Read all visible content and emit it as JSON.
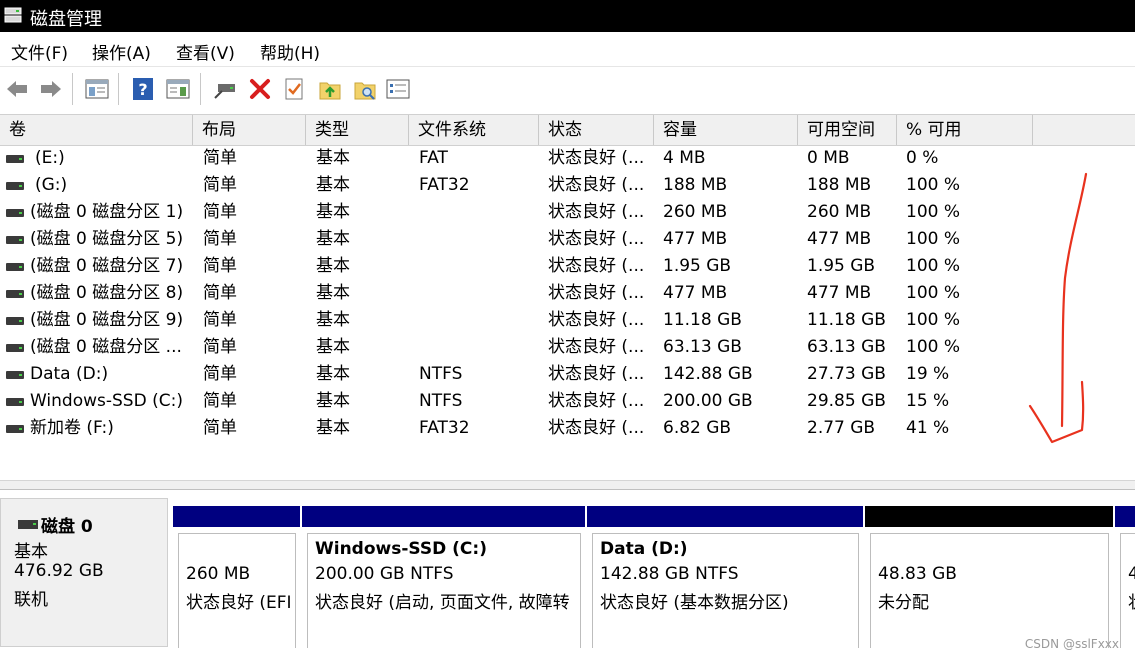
{
  "window": {
    "title": "磁盘管理"
  },
  "menu": [
    "文件(F)",
    "操作(A)",
    "查看(V)",
    "帮助(H)"
  ],
  "toolbar": [
    "back-icon",
    "forward-icon",
    "console-tree-icon",
    "help-icon",
    "action-pane-icon",
    "connect-disk-icon",
    "delete-icon",
    "check-icon",
    "folder-up-icon",
    "folder-search-icon",
    "properties-icon"
  ],
  "table": {
    "columns": [
      "卷",
      "布局",
      "类型",
      "文件系统",
      "状态",
      "容量",
      "可用空间",
      "% 可用"
    ],
    "rows": [
      [
        "(E:)",
        "简单",
        "基本",
        "FAT",
        "状态良好 (...",
        "4 MB",
        "0 MB",
        "0 %"
      ],
      [
        "(G:)",
        "简单",
        "基本",
        "FAT32",
        "状态良好 (...",
        "188 MB",
        "188 MB",
        "100 %"
      ],
      [
        "(磁盘 0 磁盘分区 1)",
        "简单",
        "基本",
        "",
        "状态良好 (...",
        "260 MB",
        "260 MB",
        "100 %"
      ],
      [
        "(磁盘 0 磁盘分区 5)",
        "简单",
        "基本",
        "",
        "状态良好 (...",
        "477 MB",
        "477 MB",
        "100 %"
      ],
      [
        "(磁盘 0 磁盘分区 7)",
        "简单",
        "基本",
        "",
        "状态良好 (...",
        "1.95 GB",
        "1.95 GB",
        "100 %"
      ],
      [
        "(磁盘 0 磁盘分区 8)",
        "简单",
        "基本",
        "",
        "状态良好 (...",
        "477 MB",
        "477 MB",
        "100 %"
      ],
      [
        "(磁盘 0 磁盘分区 9)",
        "简单",
        "基本",
        "",
        "状态良好 (...",
        "11.18 GB",
        "11.18 GB",
        "100 %"
      ],
      [
        "(磁盘 0 磁盘分区 ...",
        "简单",
        "基本",
        "",
        "状态良好 (...",
        "63.13 GB",
        "63.13 GB",
        "100 %"
      ],
      [
        "Data (D:)",
        "简单",
        "基本",
        "NTFS",
        "状态良好 (...",
        "142.88 GB",
        "27.73 GB",
        "19 %"
      ],
      [
        "Windows-SSD (C:)",
        "简单",
        "基本",
        "NTFS",
        "状态良好 (...",
        "200.00 GB",
        "29.85 GB",
        "15 %"
      ],
      [
        "新加卷 (F:)",
        "简单",
        "基本",
        "FAT32",
        "状态良好 (...",
        "6.82 GB",
        "2.77 GB",
        "41 %"
      ]
    ]
  },
  "disk": {
    "name": "磁盘 0",
    "type": "基本",
    "size": "476.92 GB",
    "status": "联机",
    "partitions": [
      {
        "title": "",
        "line1": "260 MB",
        "line2": "状态良好 (EFI",
        "bar_color": "#000080"
      },
      {
        "title": "Windows-SSD  (C:)",
        "line1": "200.00 GB NTFS",
        "line2": "状态良好 (启动, 页面文件, 故障转",
        "bar_color": "#000080"
      },
      {
        "title": "Data  (D:)",
        "line1": "142.88 GB NTFS",
        "line2": "状态良好 (基本数据分区)",
        "bar_color": "#000080"
      },
      {
        "title": "",
        "line1": "48.83 GB",
        "line2": "未分配",
        "bar_color": "#000000"
      },
      {
        "title": "",
        "line1": "4",
        "line2": "状",
        "bar_color": "#000080"
      }
    ]
  },
  "watermark": "CSDN @sslFxxx",
  "annotation_color": "#e8321e"
}
